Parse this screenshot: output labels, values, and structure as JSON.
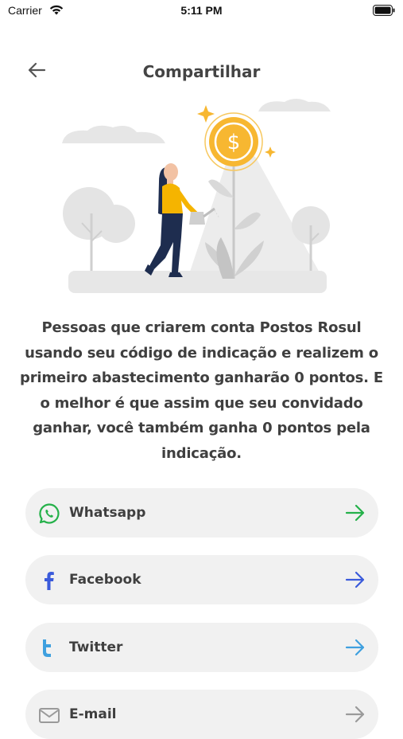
{
  "status_bar": {
    "carrier": "Carrier",
    "time": "5:11 PM"
  },
  "header": {
    "title": "Compartilhar"
  },
  "description": "Pessoas que criarem conta Postos Rosul usando seu código de indicação e realizem o primeiro abastecimento ganharão 0 pontos. E o melhor é que assim que seu convidado ganhar, você também ganha 0 pontos pela indicação.",
  "share_options": [
    {
      "label": "Whatsapp",
      "icon": "whatsapp-icon",
      "color": "#25b14a"
    },
    {
      "label": "Facebook",
      "icon": "facebook-icon",
      "color": "#3b5bdb"
    },
    {
      "label": "Twitter",
      "icon": "twitter-icon",
      "color": "#3fa0df"
    },
    {
      "label": "E-mail",
      "icon": "email-icon",
      "color": "#9a9a9a"
    }
  ],
  "colors": {
    "coin": "#f7b731",
    "shirt": "#f5b400",
    "background": "#ffffff",
    "button_bg": "#f1f1f1"
  }
}
